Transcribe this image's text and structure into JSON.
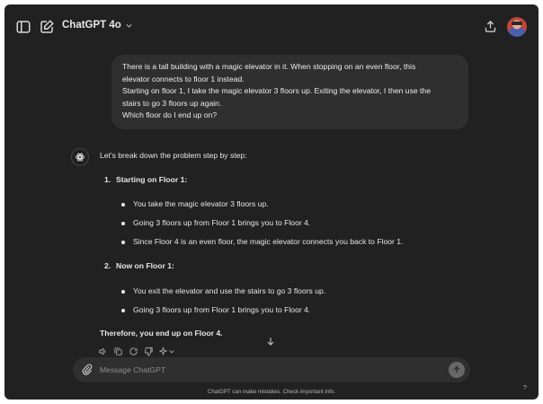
{
  "header": {
    "model_label": "ChatGPT 4o",
    "icons": [
      "sidebar-toggle-icon",
      "new-chat-icon",
      "chevron-down-icon",
      "share-icon",
      "avatar"
    ]
  },
  "user_message": {
    "lines": [
      "There is a tall building with a magic elevator in it. When stopping on an even floor, this",
      "elevator connects to floor 1 instead.",
      "Starting on floor 1, I take the magic elevator 3 floors up. Exiting the elevator, I then use the",
      "stairs to go 3 floors up again.",
      "Which floor do I end up on?"
    ]
  },
  "assistant": {
    "intro": "Let's break down the problem step by step:",
    "steps": [
      {
        "num": "1.",
        "title": "Starting on Floor 1:",
        "bullets": [
          "You take the magic elevator 3 floors up.",
          "Going 3 floors up from Floor 1 brings you to Floor 4.",
          "Since Floor 4 is an even floor, the magic elevator connects you back to Floor 1."
        ]
      },
      {
        "num": "2.",
        "title": "Now on Floor 1:",
        "bullets": [
          "You exit the elevator and use the stairs to go 3 floors up.",
          "Going 3 floors up from Floor 1 brings you to Floor 4."
        ]
      }
    ],
    "conclusion": "Therefore, you end up on Floor 4.",
    "actions": [
      "read-aloud-icon",
      "copy-icon",
      "regenerate-icon",
      "thumbs-down-icon",
      "sparkle-model-icon"
    ]
  },
  "composer": {
    "placeholder": "Message ChatGPT"
  },
  "footer": {
    "disclaimer": "ChatGPT can make mistakes. Check important info.",
    "help_label": "?"
  },
  "colors": {
    "background": "#212121",
    "bubble": "#2f2f2f",
    "text": "#ececec",
    "muted": "#8d8d8d"
  }
}
